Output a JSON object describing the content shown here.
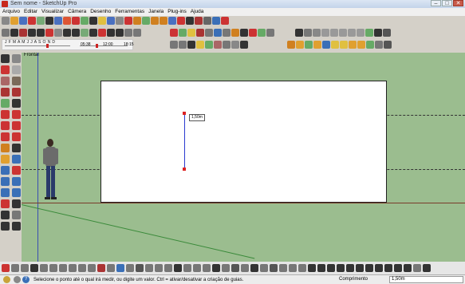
{
  "window": {
    "title": "Sem nome - SketchUp Pro",
    "minimize": "–",
    "maximize": "□",
    "close": "✕"
  },
  "menu": [
    "Arquivo",
    "Editar",
    "Visualizar",
    "Câmera",
    "Desenho",
    "Ferramentas",
    "Janela",
    "Plug-ins",
    "Ajuda"
  ],
  "shadows": {
    "months": "J F M A M J J A S O N D",
    "time_start": "05:38",
    "time_mid": "12:00",
    "time_end": "18:15"
  },
  "viewport": {
    "scene_label": "Frontal",
    "measure_tip": "1,50m"
  },
  "status": {
    "message": "Selecione o ponto até o qual irá medir, ou digite um valor. Ctrl = ativar/desativar a criação de guias.",
    "measure_label": "Comprimento",
    "measure_value": "1,50m"
  },
  "colors": {
    "viewport_bg": "#9bbd8f",
    "guide": "#333333",
    "measure_line": "#2a3ad0",
    "endpoint": "#dd2222"
  },
  "toolbar_icons": {
    "row1": [
      "#888",
      "#e0a030",
      "#4a70c0",
      "#c33",
      "#7a7",
      "#333",
      "#4a70c0",
      "#d53",
      "#c33",
      "#6a6",
      "#333",
      "#e0c040",
      "#4a70c0",
      "#888",
      "#c33",
      "#d08020",
      "#6a6",
      "#d08020",
      "#d08020",
      "#4a70c0",
      "#c33",
      "#333",
      "#a33",
      "#666",
      "#3a6fb7",
      "#c33"
    ],
    "row2": [
      "#777",
      "#333",
      "#a33",
      "#333",
      "#333",
      "#c33",
      "#888",
      "#333",
      "#333",
      "#7a7",
      "#333",
      "#c33",
      "#333",
      "#333",
      "#777",
      "#777"
    ],
    "row2b": [
      "#c33",
      "#6a6",
      "#e0c040",
      "#a33",
      "#777",
      "#3a6fb7",
      "#777",
      "#d08020",
      "#333",
      "#c33",
      "#6a6",
      "#777"
    ],
    "row2c": [
      "#333",
      "#777",
      "#888",
      "#999",
      "#999",
      "#999",
      "#999",
      "#999",
      "#6a6",
      "#333",
      "#555"
    ],
    "row3b": [
      "#777",
      "#777",
      "#333",
      "#e0c040",
      "#6a6",
      "#a66",
      "#777",
      "#888",
      "#333"
    ],
    "row3c": [
      "#d08020",
      "#e0a030",
      "#6a6",
      "#e0a030",
      "#3a6fb7",
      "#e0c040",
      "#e0c040",
      "#e0a030",
      "#e0a030",
      "#6a6",
      "#777",
      "#555"
    ],
    "left": [
      "#333",
      "#888",
      "#c33",
      "#aaa",
      "#a66",
      "#7a6a5a",
      "#a33",
      "#a33",
      "#6a6",
      "#333",
      "#c33",
      "#c33",
      "#c33",
      "#c33",
      "#c33",
      "#c33",
      "#d08020",
      "#333",
      "#e0a030",
      "#3a6fb7",
      "#3a6fb7",
      "#c33",
      "#3a6fb7",
      "#3a6fb7",
      "#3a6fb7",
      "#3a6fb7",
      "#c33",
      "#333",
      "#333",
      "#777",
      "#333",
      "#333"
    ],
    "bottom": [
      "#c33",
      "#777",
      "#777",
      "#333",
      "#777",
      "#777",
      "#777",
      "#777",
      "#777",
      "#777",
      "#a33",
      "#777",
      "#3a6fb7",
      "#777",
      "#555",
      "#777",
      "#777",
      "#777",
      "#333",
      "#777",
      "#777",
      "#777",
      "#333",
      "#777",
      "#555",
      "#777",
      "#333",
      "#777",
      "#555",
      "#777",
      "#777",
      "#777",
      "#333",
      "#333",
      "#333",
      "#333",
      "#333",
      "#333",
      "#333",
      "#333",
      "#333",
      "#333",
      "#333",
      "#777",
      "#333"
    ]
  }
}
